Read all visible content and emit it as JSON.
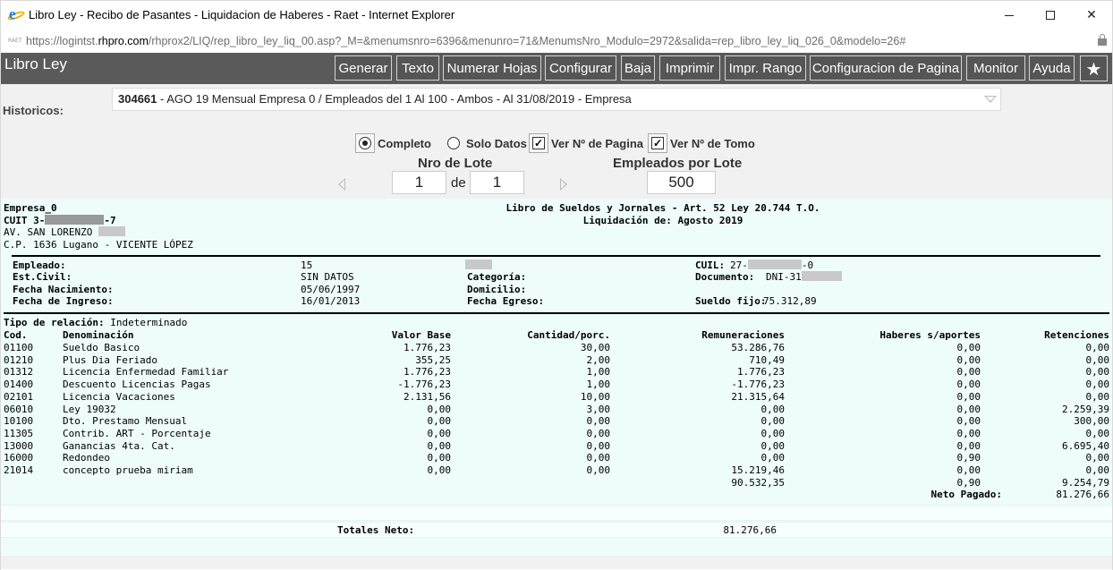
{
  "window": {
    "title": "Libro Ley - Recibo de Pasantes - Liquidacion de Haberes - Raet - Internet Explorer",
    "url_prefix": "https://logintst.",
    "url_host": "rhpro.com",
    "url_path": "/rhprox2/LIQ/rep_libro_ley_liq_00.asp?_M=&menumsnro=6396&menunro=71&MenumsNro_Modulo=2972&salida=rep_libro_ley_liq_026_0&modelo=26#",
    "min_glyph": "",
    "close_glyph": "✕",
    "favicon_text": "RAET"
  },
  "toolbar": {
    "app_title": "Libro Ley",
    "buttons": [
      "Generar",
      "Texto",
      "Numerar Hojas",
      "Configurar",
      "Baja",
      "Imprimir",
      "Impr. Rango",
      "Configuracion de Pagina",
      "Monitor",
      "Ayuda"
    ],
    "star_glyph": "★"
  },
  "filters": {
    "historicos_label": "Historicos:",
    "historico_id": "304661",
    "historico_desc": " - AGO 19 Mensual Empresa 0 / Empleados del 1 Al 100 - Ambos - Al 31/08/2019 - Empresa",
    "options": {
      "completo": "Completo",
      "solo_datos": "Solo Datos",
      "ver_pagina": "Ver Nº de Pagina",
      "ver_tomo": "Ver Nº de Tomo"
    },
    "check_glyph": "✓",
    "nro_lote_label": "Nro de Lote",
    "lote_from": "1",
    "de_label": "de",
    "lote_to": "1",
    "empleados_por_lote_label": "Empleados por Lote",
    "empleados_por_lote": "500"
  },
  "report": {
    "empresa": "Empresa_0",
    "cuit_prefix": "CUIT 3-",
    "cuit_suffix": "-7",
    "address": "AV. SAN LORENZO",
    "cp": "C.P. 1636 Lugano - VICENTE LÓPEZ",
    "title": "Libro de Sueldos y Jornales - Art. 52 Ley 20.744 T.O.",
    "liquidacion": "Liquidación de: Agosto 2019",
    "employee": {
      "empleado_label": "Empleado:",
      "empleado_value": "15",
      "cuil_label": "CUIL:",
      "cuil_prefix": "27-",
      "cuil_suffix": "-0",
      "estcivil_label": "Est.Civil:",
      "estcivil_value": "SIN DATOS",
      "categoria_label": "Categoría:",
      "documento_label": "Documento:",
      "documento_value": "DNI-31",
      "fnac_label": "Fecha Nacimiento:",
      "fnac_value": "05/06/1997",
      "domicilio_label": "Domicilio:",
      "fing_label": "Fecha de Ingreso:",
      "fing_value": "16/01/2013",
      "fegreso_label": "Fecha Egreso:",
      "sueldo_label": "Sueldo fijo:",
      "sueldo_value": "75.312,89"
    },
    "tipo_relacion_label": "Tipo de relación:",
    "tipo_relacion_value": "Indeterminado",
    "columns": {
      "cod": "Cod.",
      "denominacion": "Denominación",
      "valor_base": "Valor Base",
      "cantidad": "Cantidad/porc.",
      "remuneraciones": "Remuneraciones",
      "haberes": "Haberes s/aportes",
      "retenciones": "Retenciones"
    },
    "rows": [
      [
        "01100",
        "Sueldo Basico",
        "1.776,23",
        "30,00",
        "53.286,76",
        "0,00",
        "0,00"
      ],
      [
        "01210",
        "Plus Dia Feriado",
        "355,25",
        "2,00",
        "710,49",
        "0,00",
        "0,00"
      ],
      [
        "01312",
        "Licencia Enfermedad Familiar",
        "1.776,23",
        "1,00",
        "1.776,23",
        "0,00",
        "0,00"
      ],
      [
        "01400",
        "Descuento Licencias Pagas",
        "-1.776,23",
        "1,00",
        "-1.776,23",
        "0,00",
        "0,00"
      ],
      [
        "02101",
        "Licencia Vacaciones",
        "2.131,56",
        "10,00",
        "21.315,64",
        "0,00",
        "0,00"
      ],
      [
        "06010",
        "Ley 19032",
        "0,00",
        "3,00",
        "0,00",
        "0,00",
        "2.259,39"
      ],
      [
        "10100",
        "Dto. Prestamo Mensual",
        "0,00",
        "0,00",
        "0,00",
        "0,00",
        "300,00"
      ],
      [
        "11305",
        "Contrib. ART - Porcentaje",
        "0,00",
        "0,00",
        "0,00",
        "0,00",
        "0,00"
      ],
      [
        "13000",
        "Ganancias 4ta. Cat.",
        "0,00",
        "0,00",
        "0,00",
        "0,00",
        "6.695,40"
      ],
      [
        "16000",
        "Redondeo",
        "0,00",
        "0,00",
        "0,00",
        "0,90",
        "0,00"
      ],
      [
        "21014",
        "concepto prueba miriam",
        "0,00",
        "0,00",
        "15.219,46",
        "0,00",
        "0,00"
      ]
    ],
    "totals": {
      "remuneraciones": "90.532,35",
      "haberes": "0,90",
      "retenciones": "9.254,79"
    },
    "neto_pagado_label": "Neto Pagado:",
    "neto_pagado_value": "81.276,66",
    "totales_neto_label": "Totales Neto:",
    "totales_neto_value": "81.276,66"
  }
}
